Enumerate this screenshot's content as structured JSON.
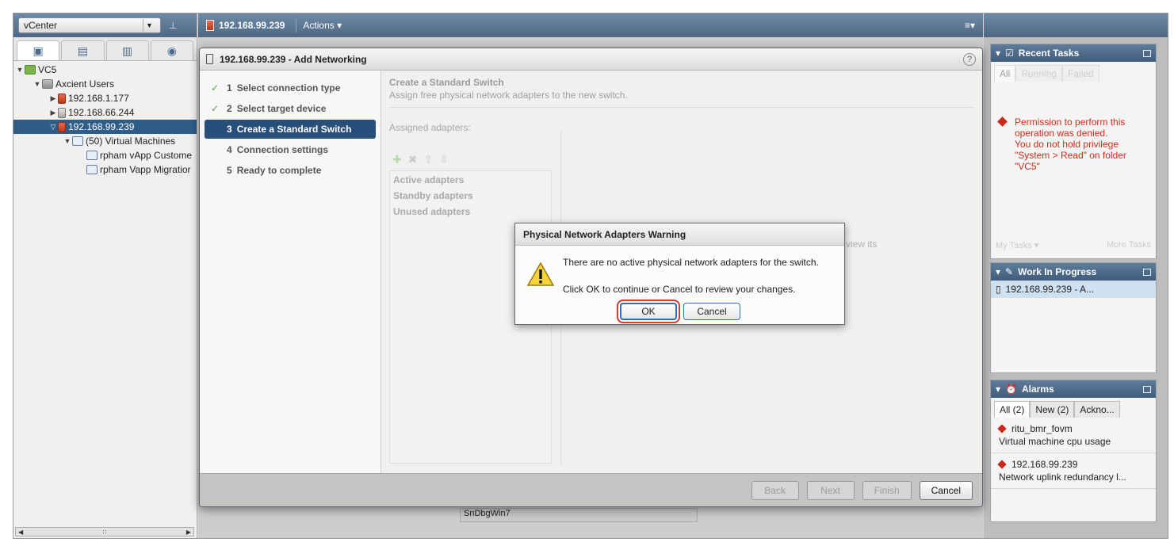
{
  "navigator": {
    "context": "vCenter",
    "tabs": [
      "hosts-and-clusters-icon",
      "vms-and-templates-icon",
      "storage-icon",
      "networking-icon"
    ],
    "tree": [
      {
        "label": "VC5",
        "level": 0
      },
      {
        "label": "Axcient Users",
        "level": 1
      },
      {
        "label": "192.168.1.177",
        "level": 2
      },
      {
        "label": "192.168.66.244",
        "level": 2
      },
      {
        "label": "192.168.99.239",
        "level": 2
      },
      {
        "label": "(50) Virtual Machines",
        "level": 3
      },
      {
        "label": "rpham vApp Custome",
        "level": 4
      },
      {
        "label": "rpham Vapp Migratior",
        "level": 4
      }
    ]
  },
  "header": {
    "object": "192.168.99.239",
    "actions": "Actions ▾"
  },
  "behind": {
    "vm_name": "SnDbgWin7"
  },
  "wizard": {
    "title": "192.168.99.239 - Add Networking",
    "steps": [
      {
        "n": "1",
        "label": "Select connection type"
      },
      {
        "n": "2",
        "label": "Select target device"
      },
      {
        "n": "3",
        "label": "Create a Standard Switch"
      },
      {
        "n": "4",
        "label": "Connection settings"
      },
      {
        "n": "5",
        "label": "Ready to complete"
      }
    ],
    "main_title": "Create a Standard Switch",
    "main_sub": "Assign free physical network adapters to the new switch.",
    "assigned_label": "Assigned adapters:",
    "adapter_groups": [
      "Active adapters",
      "Standby adapters",
      "Unused adapters"
    ],
    "hint_fragment": "view its",
    "buttons": {
      "back": "Back",
      "next": "Next",
      "finish": "Finish",
      "cancel": "Cancel"
    }
  },
  "warning": {
    "title": "Physical Network Adapters Warning",
    "line1": "There are no active physical network adapters for the switch.",
    "line2": "Click OK to continue or Cancel to review your changes.",
    "ok": "OK",
    "cancel": "Cancel"
  },
  "recent_tasks": {
    "title": "Recent Tasks",
    "tabs": [
      "All",
      "Running",
      "Failed"
    ],
    "error_lines": [
      "Permission to perform this",
      "operation was denied.",
      "You do not hold privilege",
      "\"System > Read\" on folder",
      "\"VC5\""
    ],
    "footer_left": "My Tasks ▾",
    "footer_right": "More Tasks"
  },
  "work_in_progress": {
    "title": "Work In Progress",
    "item": "192.168.99.239 - A..."
  },
  "alarms": {
    "title": "Alarms",
    "tabs": [
      "All (2)",
      "New (2)",
      "Ackno..."
    ],
    "items": [
      {
        "name": "ritu_bmr_fovm",
        "desc": "Virtual machine cpu usage"
      },
      {
        "name": "192.168.99.239",
        "desc": "Network uplink redundancy l..."
      }
    ]
  },
  "colors": {
    "accent": "#274f7a",
    "error": "#d12a1a",
    "highlight": "#d93a2b"
  }
}
